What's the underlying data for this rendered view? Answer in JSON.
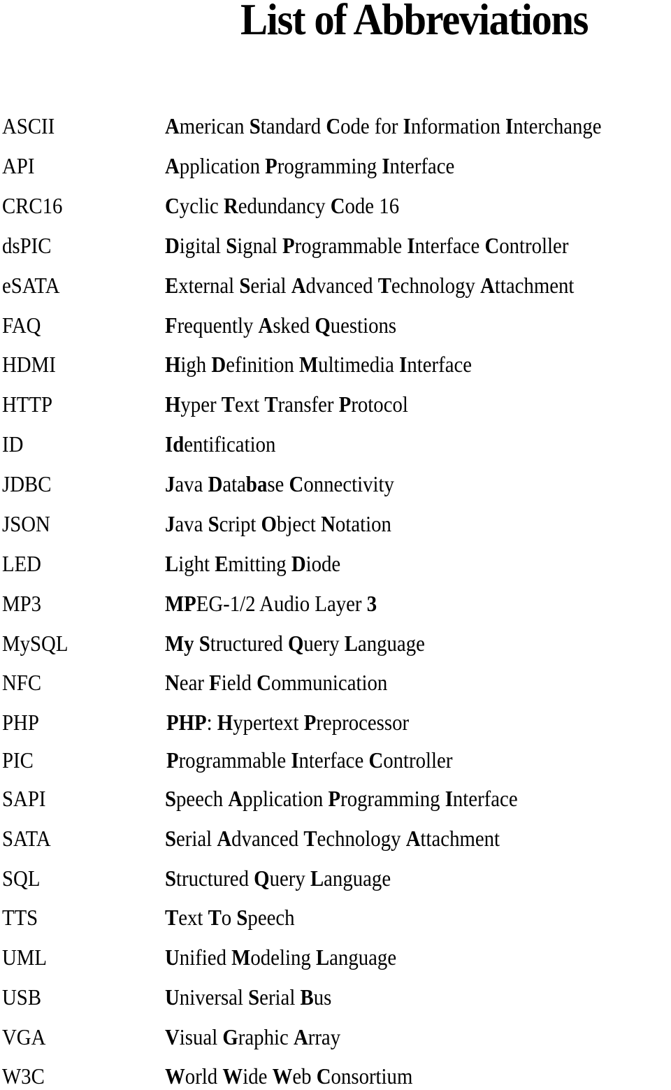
{
  "page": {
    "title": "List of Abbreviations"
  },
  "abbreviations": [
    {
      "abbr": "ASCII",
      "definition": [
        [
          "American",
          "A"
        ],
        [
          "Standard",
          "S"
        ],
        [
          "Code",
          "C"
        ],
        [
          "for",
          ""
        ],
        [
          "Information",
          "I"
        ],
        [
          "Interchange",
          "I"
        ]
      ],
      "text": "American Standard Code for Information Interchange"
    },
    {
      "abbr": "API",
      "definition": [
        [
          "Application",
          "A"
        ],
        [
          "Programming",
          "P"
        ],
        [
          "Interface",
          "I"
        ]
      ],
      "text": "Application Programming Interface"
    },
    {
      "abbr": "CRC16",
      "definition": [
        [
          "Cyclic",
          "C"
        ],
        [
          "Redundancy",
          "R"
        ],
        [
          "Code",
          "C"
        ],
        [
          "16",
          ""
        ]
      ],
      "text": "Cyclic Redundancy Code 16"
    },
    {
      "abbr": "dsPIC",
      "definition": [
        [
          "Digital",
          "D"
        ],
        [
          "Signal",
          "S"
        ],
        [
          "Programmable",
          "P"
        ],
        [
          "Interface",
          "I"
        ],
        [
          "Controller",
          "C"
        ]
      ],
      "text": "Digital Signal Programmable Interface Controller"
    },
    {
      "abbr": "eSATA",
      "definition": [
        [
          "External",
          "E"
        ],
        [
          "Serial",
          "S"
        ],
        [
          "Advanced",
          "A"
        ],
        [
          "Technology",
          "T"
        ],
        [
          "Attachment",
          "A"
        ]
      ],
      "text": "External Serial Advanced Technology Attachment"
    },
    {
      "abbr": "FAQ",
      "definition": [
        [
          "Frequently",
          "F"
        ],
        [
          "Asked",
          "A"
        ],
        [
          "Questions",
          "Q"
        ]
      ],
      "text": "Frequently Asked Questions"
    },
    {
      "abbr": "HDMI",
      "definition": [
        [
          "High",
          "H"
        ],
        [
          "Definition",
          "D"
        ],
        [
          "Multimedia",
          "M"
        ],
        [
          "Interface",
          "I"
        ]
      ],
      "text": "High Definition Multimedia Interface"
    },
    {
      "abbr": "HTTP",
      "definition": [
        [
          "Hyper",
          "H"
        ],
        [
          "Text",
          "T"
        ],
        [
          "Transfer",
          "T"
        ],
        [
          "Protocol",
          "P"
        ]
      ],
      "text": "Hyper Text Transfer Protocol"
    },
    {
      "abbr": "ID",
      "definition": [
        [
          "Identification",
          "Id"
        ]
      ],
      "text": "Identification"
    },
    {
      "abbr": "JDBC",
      "definition": [
        [
          "Java",
          "J"
        ],
        [
          "Database",
          "D",
          "ba"
        ],
        [
          "Connectivity",
          "C"
        ]
      ],
      "text": "Java Database Connectivity"
    },
    {
      "abbr": "JSON",
      "definition": [
        [
          "Java",
          "J"
        ],
        [
          "Script",
          "S"
        ],
        [
          "Object",
          "O"
        ],
        [
          "Notation",
          "N"
        ]
      ],
      "text": "Java Script Object Notation"
    },
    {
      "abbr": "LED",
      "definition": [
        [
          "Light",
          "L"
        ],
        [
          "Emitting",
          "E"
        ],
        [
          "Diode",
          "D"
        ]
      ],
      "text": "Light Emitting Diode"
    },
    {
      "abbr": "MP3",
      "definition": [
        [
          "MPEG-1/2",
          "MP"
        ],
        [
          "Audio",
          ""
        ],
        [
          "Layer",
          ""
        ],
        [
          "3",
          "3"
        ]
      ],
      "text": "MPEG-1/2 Audio Layer 3"
    },
    {
      "abbr": "MySQL",
      "definition": [
        [
          "My",
          "My"
        ],
        [
          "Structured",
          "S"
        ],
        [
          "Query",
          "Q"
        ],
        [
          "Language",
          "L"
        ]
      ],
      "text": "My Structured Query Language"
    },
    {
      "abbr": "NFC",
      "definition": [
        [
          "Near",
          "N"
        ],
        [
          "Field",
          "F"
        ],
        [
          "Communication",
          "C"
        ]
      ],
      "text": "Near Field Communication"
    },
    {
      "abbr": "PHP",
      "definition": [
        [
          "PHP:",
          "PHP"
        ],
        [
          "Hypertext",
          "H"
        ],
        [
          "Preprocessor",
          "P"
        ]
      ],
      "text": "PHP: Hypertext Preprocessor",
      "indent": true
    },
    {
      "abbr": "PIC",
      "definition": [
        [
          "Programmable",
          "P"
        ],
        [
          "Interface",
          "I"
        ],
        [
          "Controller",
          "C"
        ]
      ],
      "text": "Programmable Interface Controller",
      "indent": true
    },
    {
      "abbr": "SAPI",
      "definition": [
        [
          "Speech",
          "S"
        ],
        [
          "Application",
          "A"
        ],
        [
          "Programming",
          "P"
        ],
        [
          "Interface",
          "I"
        ]
      ],
      "text": "Speech Application Programming Interface"
    },
    {
      "abbr": "SATA",
      "definition": [
        [
          "Serial",
          "S"
        ],
        [
          "Advanced",
          "A"
        ],
        [
          "Technology",
          "T"
        ],
        [
          "Attachment",
          "A"
        ]
      ],
      "text": "Serial Advanced Technology Attachment"
    },
    {
      "abbr": "SQL",
      "definition": [
        [
          "Structured",
          "S"
        ],
        [
          "Query",
          "Q"
        ],
        [
          "Language",
          "L"
        ]
      ],
      "text": "Structured Query Language"
    },
    {
      "abbr": "TTS",
      "definition": [
        [
          "Text",
          "T"
        ],
        [
          "To",
          "T"
        ],
        [
          "Speech",
          "S"
        ]
      ],
      "text": "Text To Speech"
    },
    {
      "abbr": "UML",
      "definition": [
        [
          "Unified",
          "U"
        ],
        [
          "Modeling",
          "M"
        ],
        [
          "Language",
          "L"
        ]
      ],
      "text": "Unified Modeling Language"
    },
    {
      "abbr": "USB",
      "definition": [
        [
          "Universal",
          "U"
        ],
        [
          "Serial",
          "S"
        ],
        [
          "Bus",
          "B"
        ]
      ],
      "text": "Universal Serial Bus"
    },
    {
      "abbr": "VGA",
      "definition": [
        [
          "Visual",
          "V"
        ],
        [
          "Graphic",
          "G"
        ],
        [
          "Array",
          "A"
        ]
      ],
      "text": "Visual Graphic Array"
    },
    {
      "abbr": "W3C",
      "definition": [
        [
          "World",
          "W"
        ],
        [
          "Wide",
          "W"
        ],
        [
          "Web",
          "W"
        ],
        [
          "Consortium",
          "C"
        ]
      ],
      "text": "World Wide Web Consortium"
    }
  ]
}
